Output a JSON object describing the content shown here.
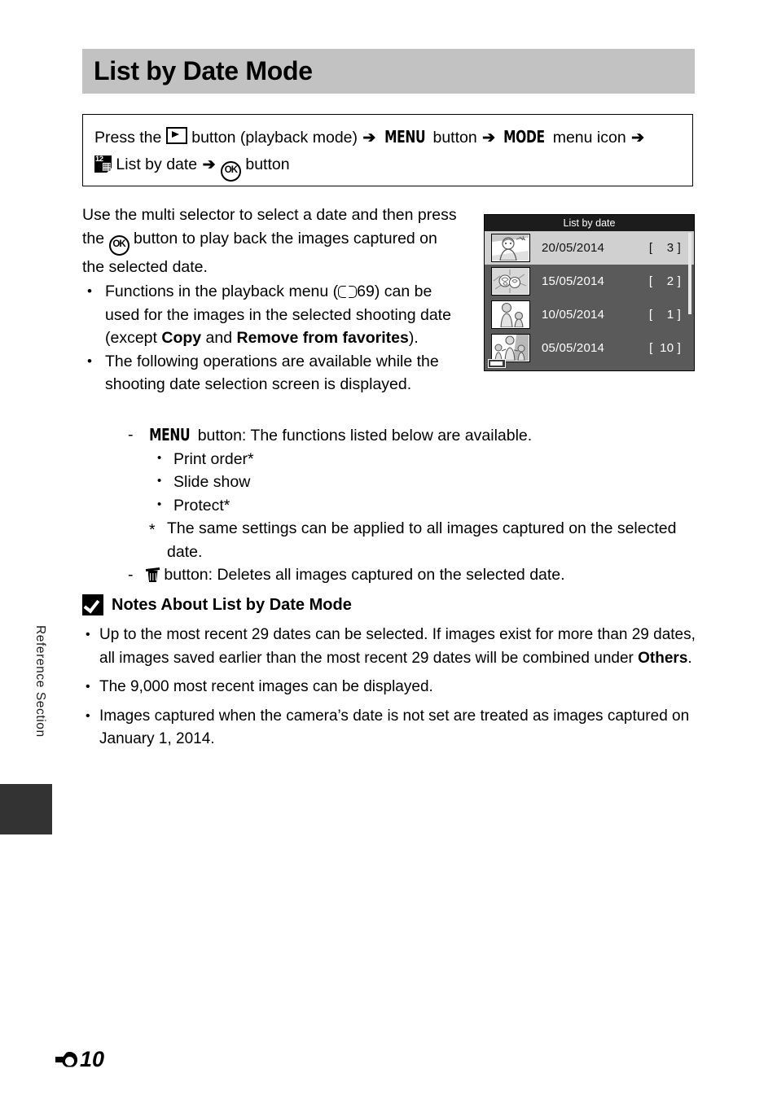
{
  "page": {
    "title": "List by Date Mode",
    "side_label": "Reference Section",
    "page_number": "10",
    "page_mark_icon": "reference-section-mark"
  },
  "path_box": {
    "line1_a": "Press the",
    "play_icon": "playback-button-icon",
    "line1_b": "button (playback mode)",
    "arrow1": "➔",
    "menu_word": "MENU",
    "line1_c": "button",
    "arrow2": "➔",
    "mode_word": "MODE",
    "line1_d": "menu icon",
    "arrow3": "➔",
    "date_icon": "list-by-date-icon",
    "line2_a": "List by date",
    "arrow4": "➔",
    "ok_icon": "OK",
    "line2_b": "button"
  },
  "body": {
    "intro_a": "Use the multi selector to select a date and then press the",
    "intro_ok": "OK",
    "intro_b": "button to play back the images captured on the selected date.",
    "bullet1_a": "Functions in the playback menu (",
    "bullet1_ref": "69",
    "bullet1_b": ") can be used for the images in the selected shooting date (except ",
    "bullet1_bold1": "Copy",
    "bullet1_c": " and ",
    "bullet1_bold2": "Remove from favorites",
    "bullet1_d": ").",
    "bullet2": "The following operations are available while the shooting date selection screen is displayed.",
    "menu_word": "MENU",
    "menu_dash": "button: The functions listed below are available.",
    "sub_items": [
      "Print order*",
      "Slide show",
      "Protect*"
    ],
    "footnote": "The same settings can be applied to all images captured on the selected date.",
    "trash_icon": "trash-button-icon",
    "trash_dash": "button: Deletes all images captured on the selected date."
  },
  "notes": {
    "icon": "notes-check-icon",
    "heading": "Notes About List by Date Mode",
    "items": [
      {
        "a": "Up to the most recent 29 dates can be selected. If images exist for more than 29 dates, all images saved earlier than the most recent 29 dates will be combined under ",
        "bold": "Others",
        "b": "."
      },
      {
        "a": "The 9,000 most recent images can be displayed.",
        "bold": "",
        "b": ""
      },
      {
        "a": "Images captured when the camera’s date is not set are treated as images captured on January 1, 2014.",
        "bold": "",
        "b": ""
      }
    ]
  },
  "lcd": {
    "title": "List by date",
    "battery_icon": "battery-icon",
    "scrollbar": "vertical-scrollbar",
    "rows": [
      {
        "date": "20/05/2014",
        "count": "[    3 ]",
        "thumb": "portrait-woman-thumbnail",
        "selected": true
      },
      {
        "date": "15/05/2014",
        "count": "[    2 ]",
        "thumb": "flowers-thumbnail",
        "selected": false
      },
      {
        "date": "10/05/2014",
        "count": "[    1 ]",
        "thumb": "woman-child-thumbnail",
        "selected": false
      },
      {
        "date": "05/05/2014",
        "count": "[  10 ]",
        "thumb": "family-thumbnail",
        "selected": false
      }
    ]
  },
  "colors": {
    "banner_gray": "#c2c2c2",
    "lcd_background": "#5a5a5a",
    "lcd_titlebar": "#1c1c1c",
    "lcd_selected_row": "#d0d0d0",
    "side_tab": "#333333"
  }
}
